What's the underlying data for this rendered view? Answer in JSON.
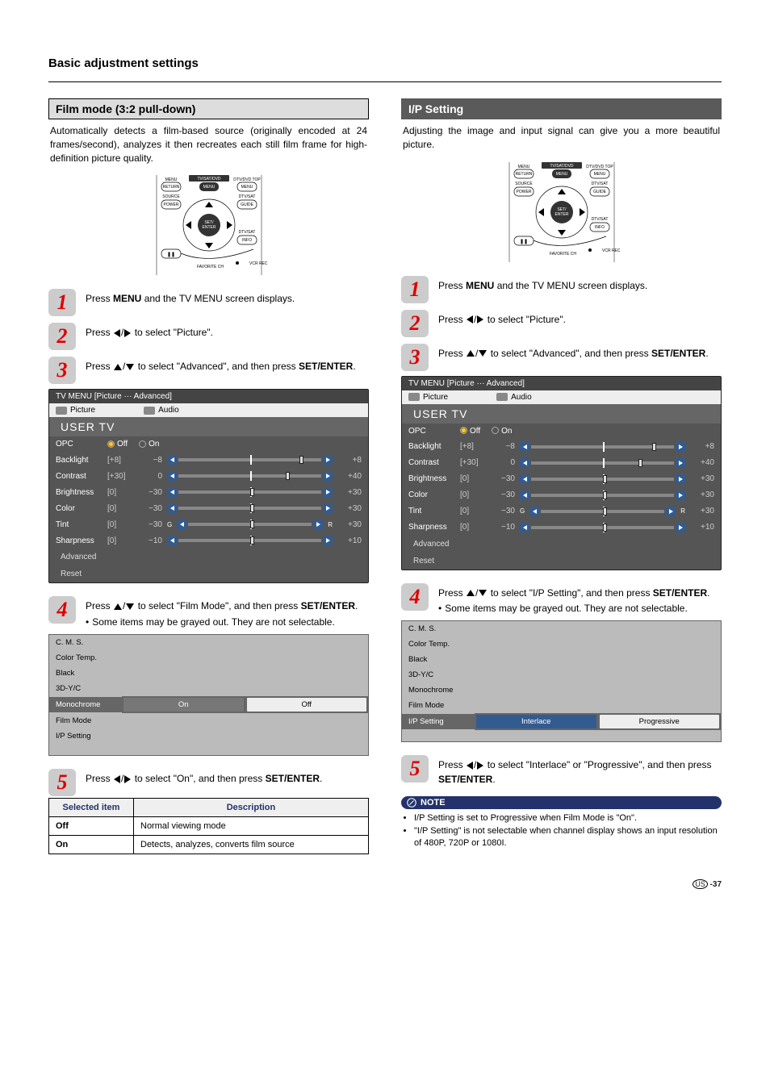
{
  "title": "Basic adjustment settings",
  "left": {
    "header": "Film mode (3:2 pull-down)",
    "intro": "Automatically detects a film-based source (originally encoded at 24 frames/second), analyzes it then recreates each still film frame for high-definition picture quality.",
    "steps": {
      "s1a": "Press ",
      "s1b": "MENU",
      "s1c": " and the TV MENU screen displays.",
      "s2a": "Press ",
      "s2b": " to select \"Picture\".",
      "s3a": "Press ",
      "s3b": " to select \"Advanced\", and then press ",
      "s3c": "SET/ENTER",
      "s3d": ".",
      "s4a": "Press ",
      "s4b": " to select \"Film Mode\", and then press ",
      "s4c": "SET/ENTER",
      "s4d": ".",
      "s4note": "Some items may be grayed out. They are not selectable.",
      "s5a": "Press ",
      "s5b": " to select \"On\", and then press ",
      "s5c": "SET/ENTER",
      "s5d": "."
    },
    "tvmenu": {
      "crumb": "TV MENU    [Picture ··· Advanced]",
      "tab1": "Picture",
      "tab2": "Audio",
      "usertv": "USER TV",
      "opc": {
        "label": "OPC",
        "off": "Off",
        "on": "On"
      },
      "rows": [
        {
          "label": "Backlight",
          "v1": "[+8]",
          "v2": "−8",
          "v3": "+8",
          "thumb": 85,
          "mk": 50
        },
        {
          "label": "Contrast",
          "v1": "[+30]",
          "v2": "0",
          "v3": "+40",
          "thumb": 75,
          "mk": 50
        },
        {
          "label": "Brightness",
          "v1": "[0]",
          "v2": "−30",
          "v3": "+30",
          "thumb": 50,
          "mk": 50
        },
        {
          "label": "Color",
          "v1": "[0]",
          "v2": "−30",
          "v3": "+30",
          "thumb": 50,
          "mk": 50
        },
        {
          "label": "Tint",
          "v1": "[0]",
          "v2": "−30",
          "v3": "+30",
          "thumb": 50,
          "mk": 50,
          "G": "G",
          "R": "R"
        },
        {
          "label": "Sharpness",
          "v1": "[0]",
          "v2": "−10",
          "v3": "+10",
          "thumb": 50,
          "mk": 50
        }
      ],
      "advanced": "Advanced",
      "reset": "Reset"
    },
    "subtable": {
      "rows": [
        "C. M. S.",
        "Color Temp.",
        "Black",
        "3D-Y/C",
        "Monochrome",
        "Film Mode",
        "I/P Setting"
      ],
      "hlIndex": 4,
      "opts": [
        "On",
        "Off"
      ]
    },
    "infoTable": {
      "h1": "Selected item",
      "h2": "Description",
      "r1a": "Off",
      "r1b": "Normal viewing mode",
      "r2a": "On",
      "r2b": "Detects, analyzes, converts film source"
    }
  },
  "right": {
    "header": "I/P Setting",
    "intro": "Adjusting the image and input signal can give you a more beautiful picture.",
    "steps": {
      "s1a": "Press ",
      "s1b": "MENU",
      "s1c": " and the TV MENU screen displays.",
      "s2a": "Press ",
      "s2b": " to select \"Picture\".",
      "s3a": "Press ",
      "s3b": " to select \"Advanced\", and then press ",
      "s3c": "SET/ENTER",
      "s3d": ".",
      "s4a": "Press ",
      "s4b": " to select \"I/P Setting\", and then press ",
      "s4c": "SET/ENTER",
      "s4d": ".",
      "s4note": "Some items may be grayed out. They are not selectable.",
      "s5a": "Press ",
      "s5b": " to select \"Interlace\" or \"Progressive\", and then press ",
      "s5c": "SET/ENTER",
      "s5d": "."
    },
    "subtable": {
      "rows": [
        "C. M. S.",
        "Color Temp.",
        "Black",
        "3D-Y/C",
        "Monochrome",
        "Film Mode",
        "I/P Setting"
      ],
      "hlIndex": 6,
      "opts": [
        "Interlace",
        "Progressive"
      ]
    },
    "noteLabel": "NOTE",
    "notes": [
      "I/P Setting is set to Progressive when Film Mode is \"On\".",
      "\"I/P Setting\" is not selectable when channel display shows an input resolution of 480P, 720P or 1080I."
    ]
  },
  "remoteLabels": {
    "menu": "MENU",
    "tvsatdvd": "TV/SAT/DVD",
    "dtvdvdtop": "DTV/DVD TOP",
    "return": "RETURN",
    "menubtn": "MENU",
    "source": "SOURCE",
    "dtvsat": "DTV/SAT",
    "power": "POWER",
    "guide": "GUIDE",
    "set": "SET/",
    "enter": "ENTER",
    "info": "INFO",
    "favorite": "FAVORITE CH",
    "vcr": "VCR REC",
    "pause": "❚❚"
  },
  "footer": {
    "us": "US",
    "page": "-37"
  }
}
